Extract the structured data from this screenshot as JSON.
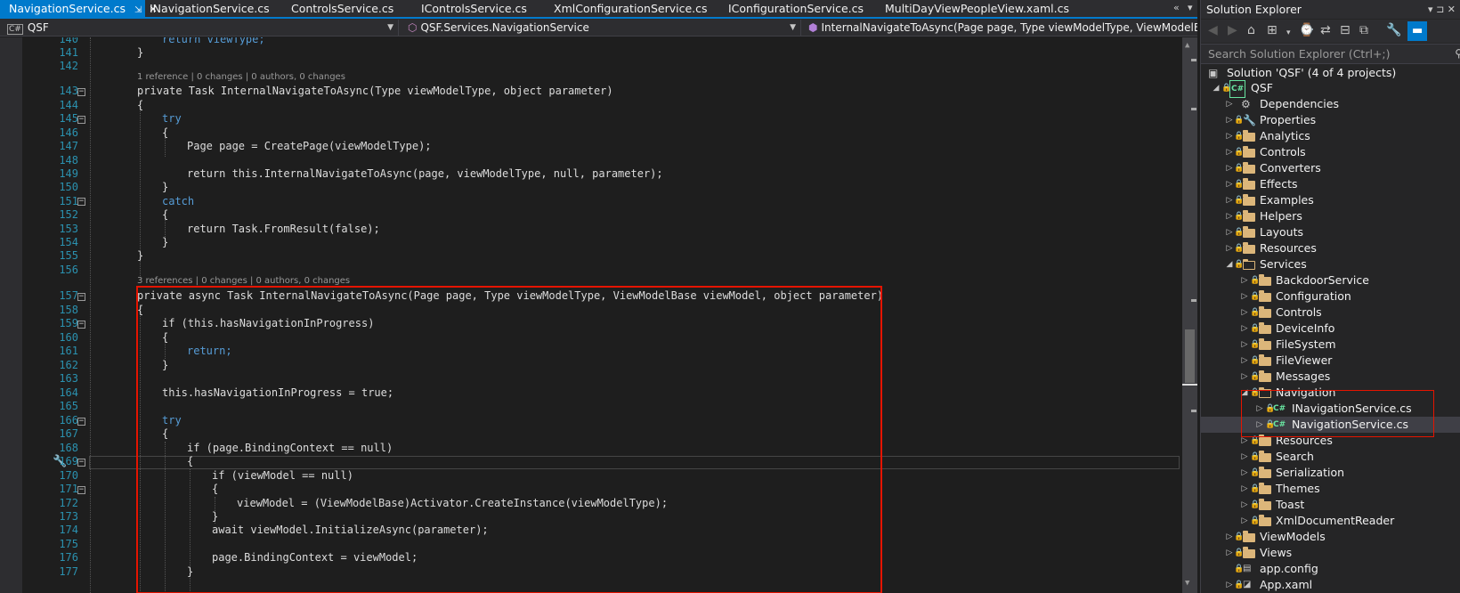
{
  "tabs": [
    {
      "label": "NavigationService.cs",
      "active": true,
      "pin": "⇲",
      "close": "✕"
    },
    {
      "label": "INavigationService.cs"
    },
    {
      "label": "ControlsService.cs"
    },
    {
      "label": "IControlsService.cs"
    },
    {
      "label": "XmlConfigurationService.cs"
    },
    {
      "label": "IConfigurationService.cs"
    },
    {
      "label": "MultiDayViewPeopleView.xaml.cs"
    }
  ],
  "tab_controls": {
    "overflow": "«",
    "menu": "▾"
  },
  "navbar": {
    "project": "QSF",
    "project_icon": "C#",
    "type": "QSF.Services.NavigationService",
    "member": "InternalNavigateToAsync(Page page, Type viewModelType, ViewModelBase vi",
    "dropdown_icon": "chevron-down-icon"
  },
  "code": {
    "lines": [
      {
        "n": "140",
        "text": "return viewType;"
      },
      {
        "n": "141",
        "text": "}"
      },
      {
        "n": "142",
        "text": ""
      },
      {
        "lens": "1 reference | 0 changes | 0 authors, 0 changes"
      },
      {
        "n": "143",
        "text": "private Task InternalNavigateToAsync(Type viewModelType, object parameter)"
      },
      {
        "n": "144",
        "text": "{"
      },
      {
        "n": "145",
        "text": "try"
      },
      {
        "n": "146",
        "text": "{"
      },
      {
        "n": "147",
        "text": "Page page = CreatePage(viewModelType);"
      },
      {
        "n": "148",
        "text": ""
      },
      {
        "n": "149",
        "text": "return this.InternalNavigateToAsync(page, viewModelType, null, parameter);"
      },
      {
        "n": "150",
        "text": "}"
      },
      {
        "n": "151",
        "text": "catch"
      },
      {
        "n": "152",
        "text": "{"
      },
      {
        "n": "153",
        "text": "return Task.FromResult(false);"
      },
      {
        "n": "154",
        "text": "}"
      },
      {
        "n": "155",
        "text": "}"
      },
      {
        "n": "156",
        "text": ""
      },
      {
        "lens": "3 references | 0 changes | 0 authors, 0 changes"
      },
      {
        "n": "157",
        "text": "private async Task InternalNavigateToAsync(Page page, Type viewModelType, ViewModelBase viewModel, object parameter)"
      },
      {
        "n": "158",
        "text": "{"
      },
      {
        "n": "159",
        "text": "if (this.hasNavigationInProgress)"
      },
      {
        "n": "160",
        "text": "{"
      },
      {
        "n": "161",
        "text": "return;"
      },
      {
        "n": "162",
        "text": "}"
      },
      {
        "n": "163",
        "text": ""
      },
      {
        "n": "164",
        "text": "this.hasNavigationInProgress = true;"
      },
      {
        "n": "165",
        "text": ""
      },
      {
        "n": "166",
        "text": "try"
      },
      {
        "n": "167",
        "text": "{"
      },
      {
        "n": "168",
        "text": "if (page.BindingContext == null)"
      },
      {
        "n": "169",
        "text": "{"
      },
      {
        "n": "170",
        "text": "if (viewModel == null)"
      },
      {
        "n": "171",
        "text": "{"
      },
      {
        "n": "172",
        "text": "viewModel = (ViewModelBase)Activator.CreateInstance(viewModelType);"
      },
      {
        "n": "173",
        "text": "}"
      },
      {
        "n": "174",
        "text": "await viewModel.InitializeAsync(parameter);"
      },
      {
        "n": "175",
        "text": ""
      },
      {
        "n": "176",
        "text": "page.BindingContext = viewModel;"
      },
      {
        "n": "177",
        "text": "}"
      }
    ]
  },
  "solution_explorer": {
    "title": "Solution Explorer",
    "title_buttons": "▾ ⊐ ✕",
    "search_placeholder": "Search Solution Explorer (Ctrl+;)",
    "toolbar_icons": [
      "back-icon",
      "forward-icon",
      "home-icon",
      "switch-views-icon",
      "pending-changes-icon",
      "sync-icon",
      "collapse-all-icon",
      "show-all-files-icon",
      "properties-icon",
      "preview-icon"
    ],
    "solution": "Solution 'QSF' (4 of 4 projects)",
    "project": "QSF",
    "items": [
      {
        "label": "Dependencies"
      },
      {
        "label": "Properties"
      },
      {
        "label": "Analytics"
      },
      {
        "label": "Controls"
      },
      {
        "label": "Converters"
      },
      {
        "label": "Effects"
      },
      {
        "label": "Examples"
      },
      {
        "label": "Helpers"
      },
      {
        "label": "Layouts"
      },
      {
        "label": "Resources"
      },
      {
        "label": "Services"
      },
      {
        "label": "BackdoorService"
      },
      {
        "label": "Configuration"
      },
      {
        "label": "Controls"
      },
      {
        "label": "DeviceInfo"
      },
      {
        "label": "FileSystem"
      },
      {
        "label": "FileViewer"
      },
      {
        "label": "Messages"
      },
      {
        "label": "Navigation"
      },
      {
        "label": "INavigationService.cs"
      },
      {
        "label": "NavigationService.cs"
      },
      {
        "label": "Resources"
      },
      {
        "label": "Search"
      },
      {
        "label": "Serialization"
      },
      {
        "label": "Themes"
      },
      {
        "label": "Toast"
      },
      {
        "label": "XmlDocumentReader"
      },
      {
        "label": "ViewModels"
      },
      {
        "label": "Views"
      },
      {
        "label": "app.config"
      },
      {
        "label": "App.xaml"
      }
    ]
  },
  "colors": {
    "accent": "#007acc",
    "highlight_box": "#e51400",
    "keyword": "#569cd6",
    "type": "#4ec9b0",
    "line_number": "#2b91af"
  }
}
